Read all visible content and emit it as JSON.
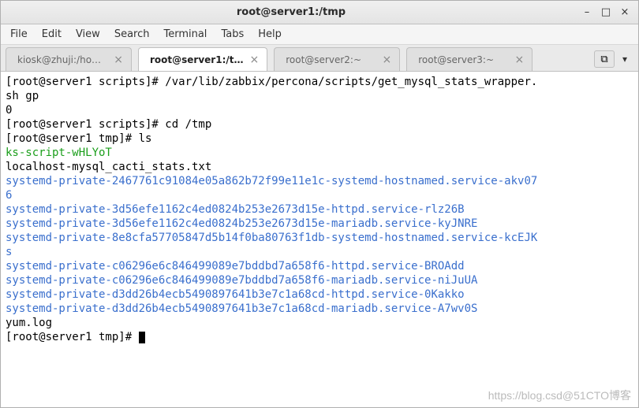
{
  "window": {
    "title": "root@server1:/tmp",
    "minimize": "–",
    "maximize": "□",
    "close": "×"
  },
  "menu": {
    "file": "File",
    "edit": "Edit",
    "view": "View",
    "search": "Search",
    "terminal": "Terminal",
    "tabs": "Tabs",
    "help": "Help"
  },
  "tabs": [
    {
      "label": "kiosk@zhuji:/ho…",
      "active": false
    },
    {
      "label": "root@server1:/t…",
      "active": true
    },
    {
      "label": "root@server2:~",
      "active": false
    },
    {
      "label": "root@server3:~",
      "active": false
    }
  ],
  "newtab_icon": "⧉",
  "tab_menu_icon": "▾",
  "term": {
    "l01a": "[root@server1 scripts]# /var/lib/zabbix/percona/scripts/get_mysql_stats_wrapper.",
    "l01b": "sh gp",
    "l02": "0",
    "l03": "[root@server1 scripts]# cd /tmp",
    "l04": "[root@server1 tmp]# ls",
    "l05": "ks-script-wHLYoT",
    "l06": "localhost-mysql_cacti_stats.txt",
    "l07a": "systemd-private-2467761c91084e05a862b72f99e11e1c-systemd-hostnamed.service-akv07",
    "l07b": "6",
    "l08": "systemd-private-3d56efe1162c4ed0824b253e2673d15e-httpd.service-rlz26B",
    "l09": "systemd-private-3d56efe1162c4ed0824b253e2673d15e-mariadb.service-kyJNRE",
    "l10a": "systemd-private-8e8cfa57705847d5b14f0ba80763f1db-systemd-hostnamed.service-kcEJK",
    "l10b": "s",
    "l11": "systemd-private-c06296e6c846499089e7bddbd7a658f6-httpd.service-BROAdd",
    "l12": "systemd-private-c06296e6c846499089e7bddbd7a658f6-mariadb.service-niJuUA",
    "l13": "systemd-private-d3dd26b4ecb5490897641b3e7c1a68cd-httpd.service-0Kakko",
    "l14": "systemd-private-d3dd26b4ecb5490897641b3e7c1a68cd-mariadb.service-A7wv0S",
    "l15": "yum.log",
    "l16": "[root@server1 tmp]# "
  },
  "watermark": "https://blog.csd@51CTO博客"
}
